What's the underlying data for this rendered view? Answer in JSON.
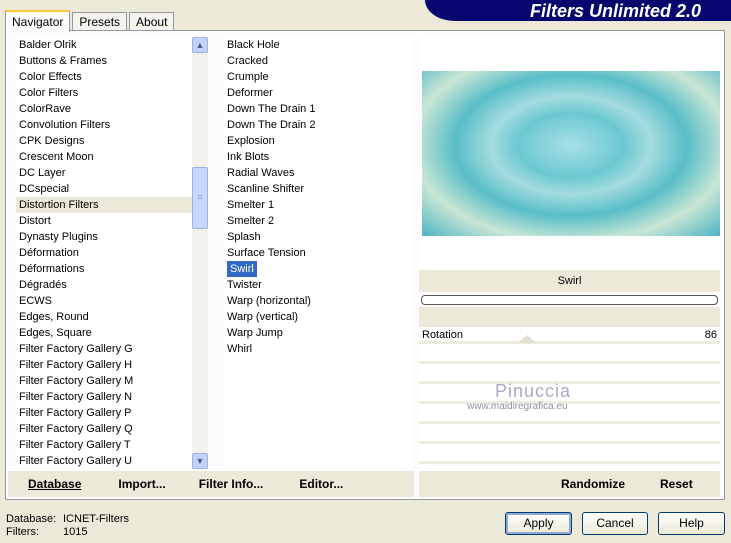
{
  "title": "Filters Unlimited 2.0",
  "tabs": [
    "Navigator",
    "Presets",
    "About"
  ],
  "categories": [
    "Balder Olrik",
    "Buttons & Frames",
    "Color Effects",
    "Color Filters",
    "ColorRave",
    "Convolution Filters",
    "CPK Designs",
    "Crescent Moon",
    "DC Layer",
    "DCspecial",
    "Distortion Filters",
    "Distort",
    "Dynasty Plugins",
    "Déformation",
    "Déformations",
    "Dégradés",
    "ECWS",
    "Edges, Round",
    "Edges, Square",
    "Filter Factory Gallery G",
    "Filter Factory Gallery H",
    "Filter Factory Gallery M",
    "Filter Factory Gallery N",
    "Filter Factory Gallery P",
    "Filter Factory Gallery Q",
    "Filter Factory Gallery T",
    "Filter Factory Gallery U"
  ],
  "selected_category": "Distortion Filters",
  "filters": [
    "Black Hole",
    "Cracked",
    "Crumple",
    "Deformer",
    "Down The Drain 1",
    "Down The Drain 2",
    "Explosion",
    "Ink Blots",
    "Radial Waves",
    "Scanline Shifter",
    "Smelter 1",
    "Smelter 2",
    "Splash",
    "Surface Tension",
    "Swirl",
    "Twister",
    "Warp (horizontal)",
    "Warp (vertical)",
    "Warp Jump",
    "Whirl"
  ],
  "selected_filter": "Swirl",
  "bottom_buttons": {
    "database": "Database",
    "import": "Import...",
    "filter_info": "Filter Info...",
    "editor": "Editor..."
  },
  "filter_name": "Swirl",
  "sliders": [
    {
      "label": "Rotation",
      "value": "86",
      "fraction": 0.337
    }
  ],
  "watermark": {
    "name": "Pinuccia",
    "url": "www.maidiregrafica.eu"
  },
  "right_buttons": {
    "randomize": "Randomize",
    "reset": "Reset"
  },
  "status": {
    "database_label": "Database:",
    "database_value": "ICNET-Filters",
    "filters_label": "Filters:",
    "filters_value": "1015"
  },
  "dialog_buttons": {
    "apply": "Apply",
    "cancel": "Cancel",
    "help": "Help"
  }
}
